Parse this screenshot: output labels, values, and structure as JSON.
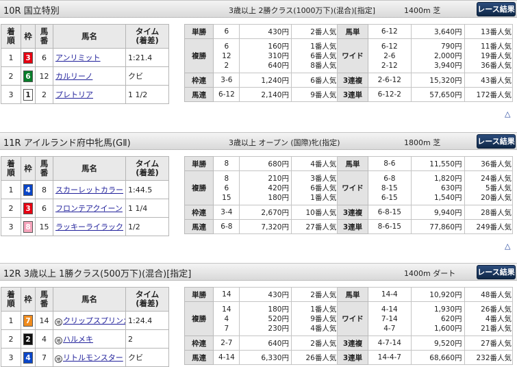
{
  "races": [
    {
      "name": "10R 国立特別",
      "cond": "3歳以上 2勝クラス(1000万下)(混合)[指定]",
      "dist": "1400m 芝",
      "btn": "レース結果",
      "headers": [
        "着\n順",
        "枠",
        "馬\n番",
        "馬名",
        "タイム\n(着差)"
      ],
      "rows": [
        {
          "pos": "1",
          "waku": "3",
          "num": "6",
          "name": "アンリミット",
          "time": "1:21.4",
          "mark": ""
        },
        {
          "pos": "2",
          "waku": "6",
          "num": "12",
          "name": "カルリーノ",
          "time": "クビ",
          "mark": ""
        },
        {
          "pos": "3",
          "waku": "1",
          "num": "2",
          "name": "プレトリア",
          "time": "1 1/2",
          "mark": ""
        }
      ],
      "pay": [
        {
          "l": "単勝",
          "n": "6",
          "y": "430円",
          "p": "2番人気",
          "l2": "馬単",
          "n2": "6-12",
          "y2": "3,640円",
          "p2": "13番人気"
        },
        {
          "l": "複勝",
          "n": "6\n12\n2",
          "y": "160円\n310円\n640円",
          "p": "1番人気\n6番人気\n8番人気",
          "l2": "ワイド",
          "n2": "6-12\n2-6\n2-12",
          "y2": "790円\n2,000円\n3,940円",
          "p2": "11番人気\n19番人気\n36番人気"
        },
        {
          "l": "枠連",
          "n": "3-6",
          "y": "1,240円",
          "p": "6番人気",
          "l2": "3連複",
          "n2": "2-6-12",
          "y2": "15,320円",
          "p2": "43番人気"
        },
        {
          "l": "馬連",
          "n": "6-12",
          "y": "2,140円",
          "p": "9番人気",
          "l2": "3連単",
          "n2": "6-12-2",
          "y2": "57,650円",
          "p2": "172番人気"
        }
      ]
    },
    {
      "name": "11R アイルランド府中牝馬(GⅡ)",
      "cond": "3歳以上 オープン (国際)牝(指定)",
      "dist": "1800m 芝",
      "btn": "レース結果",
      "headers": [
        "着\n順",
        "枠",
        "馬\n番",
        "馬名",
        "タイム\n(着差)"
      ],
      "rows": [
        {
          "pos": "1",
          "waku": "4",
          "num": "8",
          "name": "スカーレットカラー",
          "time": "1:44.5",
          "mark": ""
        },
        {
          "pos": "2",
          "waku": "3",
          "num": "6",
          "name": "フロンテアクイーン",
          "time": "1 1/4",
          "mark": ""
        },
        {
          "pos": "3",
          "waku": "8",
          "num": "15",
          "name": "ラッキーライラック",
          "time": "1/2",
          "mark": ""
        }
      ],
      "pay": [
        {
          "l": "単勝",
          "n": "8",
          "y": "680円",
          "p": "4番人気",
          "l2": "馬単",
          "n2": "8-6",
          "y2": "11,550円",
          "p2": "36番人気"
        },
        {
          "l": "複勝",
          "n": "8\n6\n15",
          "y": "210円\n420円\n180円",
          "p": "3番人気\n6番人気\n1番人気",
          "l2": "ワイド",
          "n2": "6-8\n8-15\n6-15",
          "y2": "1,820円\n630円\n1,540円",
          "p2": "24番人気\n5番人気\n20番人気"
        },
        {
          "l": "枠連",
          "n": "3-4",
          "y": "2,670円",
          "p": "10番人気",
          "l2": "3連複",
          "n2": "6-8-15",
          "y2": "9,940円",
          "p2": "28番人気"
        },
        {
          "l": "馬連",
          "n": "6-8",
          "y": "7,320円",
          "p": "27番人気",
          "l2": "3連単",
          "n2": "8-6-15",
          "y2": "77,860円",
          "p2": "249番人気"
        }
      ]
    },
    {
      "name": "12R 3歳以上 1勝クラス(500万下)(混合)[指定]",
      "cond": "",
      "dist": "1400m ダート",
      "btn": "レース結果",
      "headers": [
        "着\n順",
        "枠",
        "馬\n番",
        "馬名",
        "タイム\n(着差)"
      ],
      "rows": [
        {
          "pos": "1",
          "waku": "7",
          "num": "14",
          "name": "クリップスプリンガ",
          "time": "1:24.4",
          "mark": "地"
        },
        {
          "pos": "2",
          "waku": "2",
          "num": "4",
          "name": "ハルメキ",
          "time": "2",
          "mark": "地"
        },
        {
          "pos": "3",
          "waku": "4",
          "num": "7",
          "name": "リトルモンスター",
          "time": "クビ",
          "mark": "地"
        }
      ],
      "pay": [
        {
          "l": "単勝",
          "n": "14",
          "y": "430円",
          "p": "2番人気",
          "l2": "馬単",
          "n2": "14-4",
          "y2": "10,920円",
          "p2": "48番人気"
        },
        {
          "l": "複勝",
          "n": "14\n4\n7",
          "y": "180円\n520円\n230円",
          "p": "1番人気\n9番人気\n4番人気",
          "l2": "ワイド",
          "n2": "4-14\n7-14\n4-7",
          "y2": "1,930円\n620円\n1,600円",
          "p2": "26番人気\n4番人気\n21番人気"
        },
        {
          "l": "枠連",
          "n": "2-7",
          "y": "640円",
          "p": "2番人気",
          "l2": "3連複",
          "n2": "4-7-14",
          "y2": "9,520円",
          "p2": "27番人気"
        },
        {
          "l": "馬連",
          "n": "4-14",
          "y": "6,330円",
          "p": "26番人気",
          "l2": "3連単",
          "n2": "14-4-7",
          "y2": "68,660円",
          "p2": "232番人気"
        }
      ]
    }
  ],
  "up_icon": "△"
}
